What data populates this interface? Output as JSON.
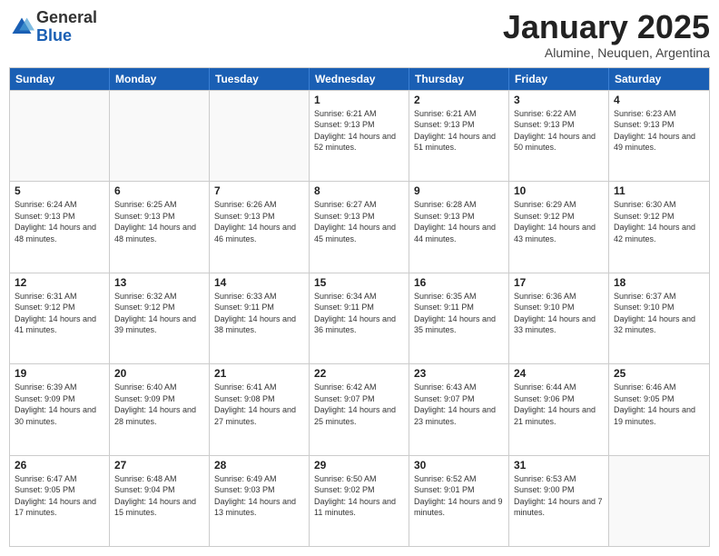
{
  "logo": {
    "general": "General",
    "blue": "Blue"
  },
  "title": "January 2025",
  "subtitle": "Alumine, Neuquen, Argentina",
  "header": {
    "days": [
      "Sunday",
      "Monday",
      "Tuesday",
      "Wednesday",
      "Thursday",
      "Friday",
      "Saturday"
    ]
  },
  "weeks": [
    [
      {
        "date": "",
        "sunrise": "",
        "sunset": "",
        "daylight": ""
      },
      {
        "date": "",
        "sunrise": "",
        "sunset": "",
        "daylight": ""
      },
      {
        "date": "",
        "sunrise": "",
        "sunset": "",
        "daylight": ""
      },
      {
        "date": "1",
        "sunrise": "Sunrise: 6:21 AM",
        "sunset": "Sunset: 9:13 PM",
        "daylight": "Daylight: 14 hours and 52 minutes."
      },
      {
        "date": "2",
        "sunrise": "Sunrise: 6:21 AM",
        "sunset": "Sunset: 9:13 PM",
        "daylight": "Daylight: 14 hours and 51 minutes."
      },
      {
        "date": "3",
        "sunrise": "Sunrise: 6:22 AM",
        "sunset": "Sunset: 9:13 PM",
        "daylight": "Daylight: 14 hours and 50 minutes."
      },
      {
        "date": "4",
        "sunrise": "Sunrise: 6:23 AM",
        "sunset": "Sunset: 9:13 PM",
        "daylight": "Daylight: 14 hours and 49 minutes."
      }
    ],
    [
      {
        "date": "5",
        "sunrise": "Sunrise: 6:24 AM",
        "sunset": "Sunset: 9:13 PM",
        "daylight": "Daylight: 14 hours and 48 minutes."
      },
      {
        "date": "6",
        "sunrise": "Sunrise: 6:25 AM",
        "sunset": "Sunset: 9:13 PM",
        "daylight": "Daylight: 14 hours and 48 minutes."
      },
      {
        "date": "7",
        "sunrise": "Sunrise: 6:26 AM",
        "sunset": "Sunset: 9:13 PM",
        "daylight": "Daylight: 14 hours and 46 minutes."
      },
      {
        "date": "8",
        "sunrise": "Sunrise: 6:27 AM",
        "sunset": "Sunset: 9:13 PM",
        "daylight": "Daylight: 14 hours and 45 minutes."
      },
      {
        "date": "9",
        "sunrise": "Sunrise: 6:28 AM",
        "sunset": "Sunset: 9:13 PM",
        "daylight": "Daylight: 14 hours and 44 minutes."
      },
      {
        "date": "10",
        "sunrise": "Sunrise: 6:29 AM",
        "sunset": "Sunset: 9:12 PM",
        "daylight": "Daylight: 14 hours and 43 minutes."
      },
      {
        "date": "11",
        "sunrise": "Sunrise: 6:30 AM",
        "sunset": "Sunset: 9:12 PM",
        "daylight": "Daylight: 14 hours and 42 minutes."
      }
    ],
    [
      {
        "date": "12",
        "sunrise": "Sunrise: 6:31 AM",
        "sunset": "Sunset: 9:12 PM",
        "daylight": "Daylight: 14 hours and 41 minutes."
      },
      {
        "date": "13",
        "sunrise": "Sunrise: 6:32 AM",
        "sunset": "Sunset: 9:12 PM",
        "daylight": "Daylight: 14 hours and 39 minutes."
      },
      {
        "date": "14",
        "sunrise": "Sunrise: 6:33 AM",
        "sunset": "Sunset: 9:11 PM",
        "daylight": "Daylight: 14 hours and 38 minutes."
      },
      {
        "date": "15",
        "sunrise": "Sunrise: 6:34 AM",
        "sunset": "Sunset: 9:11 PM",
        "daylight": "Daylight: 14 hours and 36 minutes."
      },
      {
        "date": "16",
        "sunrise": "Sunrise: 6:35 AM",
        "sunset": "Sunset: 9:11 PM",
        "daylight": "Daylight: 14 hours and 35 minutes."
      },
      {
        "date": "17",
        "sunrise": "Sunrise: 6:36 AM",
        "sunset": "Sunset: 9:10 PM",
        "daylight": "Daylight: 14 hours and 33 minutes."
      },
      {
        "date": "18",
        "sunrise": "Sunrise: 6:37 AM",
        "sunset": "Sunset: 9:10 PM",
        "daylight": "Daylight: 14 hours and 32 minutes."
      }
    ],
    [
      {
        "date": "19",
        "sunrise": "Sunrise: 6:39 AM",
        "sunset": "Sunset: 9:09 PM",
        "daylight": "Daylight: 14 hours and 30 minutes."
      },
      {
        "date": "20",
        "sunrise": "Sunrise: 6:40 AM",
        "sunset": "Sunset: 9:09 PM",
        "daylight": "Daylight: 14 hours and 28 minutes."
      },
      {
        "date": "21",
        "sunrise": "Sunrise: 6:41 AM",
        "sunset": "Sunset: 9:08 PM",
        "daylight": "Daylight: 14 hours and 27 minutes."
      },
      {
        "date": "22",
        "sunrise": "Sunrise: 6:42 AM",
        "sunset": "Sunset: 9:07 PM",
        "daylight": "Daylight: 14 hours and 25 minutes."
      },
      {
        "date": "23",
        "sunrise": "Sunrise: 6:43 AM",
        "sunset": "Sunset: 9:07 PM",
        "daylight": "Daylight: 14 hours and 23 minutes."
      },
      {
        "date": "24",
        "sunrise": "Sunrise: 6:44 AM",
        "sunset": "Sunset: 9:06 PM",
        "daylight": "Daylight: 14 hours and 21 minutes."
      },
      {
        "date": "25",
        "sunrise": "Sunrise: 6:46 AM",
        "sunset": "Sunset: 9:05 PM",
        "daylight": "Daylight: 14 hours and 19 minutes."
      }
    ],
    [
      {
        "date": "26",
        "sunrise": "Sunrise: 6:47 AM",
        "sunset": "Sunset: 9:05 PM",
        "daylight": "Daylight: 14 hours and 17 minutes."
      },
      {
        "date": "27",
        "sunrise": "Sunrise: 6:48 AM",
        "sunset": "Sunset: 9:04 PM",
        "daylight": "Daylight: 14 hours and 15 minutes."
      },
      {
        "date": "28",
        "sunrise": "Sunrise: 6:49 AM",
        "sunset": "Sunset: 9:03 PM",
        "daylight": "Daylight: 14 hours and 13 minutes."
      },
      {
        "date": "29",
        "sunrise": "Sunrise: 6:50 AM",
        "sunset": "Sunset: 9:02 PM",
        "daylight": "Daylight: 14 hours and 11 minutes."
      },
      {
        "date": "30",
        "sunrise": "Sunrise: 6:52 AM",
        "sunset": "Sunset: 9:01 PM",
        "daylight": "Daylight: 14 hours and 9 minutes."
      },
      {
        "date": "31",
        "sunrise": "Sunrise: 6:53 AM",
        "sunset": "Sunset: 9:00 PM",
        "daylight": "Daylight: 14 hours and 7 minutes."
      },
      {
        "date": "",
        "sunrise": "",
        "sunset": "",
        "daylight": ""
      }
    ]
  ]
}
